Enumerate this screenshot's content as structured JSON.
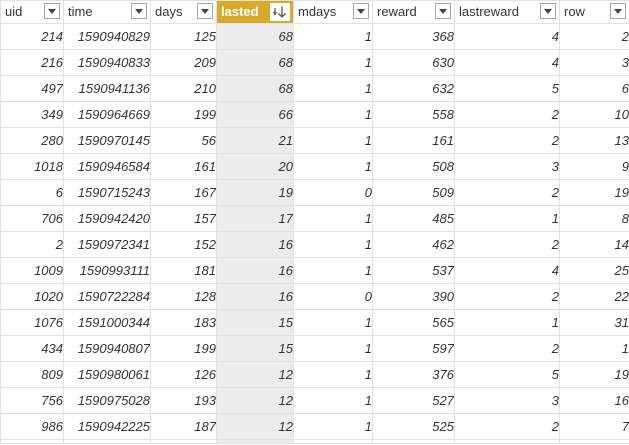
{
  "columns": [
    {
      "label": "uid"
    },
    {
      "label": "time"
    },
    {
      "label": "days"
    },
    {
      "label": "lasted"
    },
    {
      "label": "mdays"
    },
    {
      "label": "reward"
    },
    {
      "label": "lastreward"
    },
    {
      "label": "row"
    }
  ],
  "sorted_column": "lasted",
  "sort_direction": "descending",
  "header_accent_color": "#d8aa2a",
  "rows": [
    [
      "214",
      "1590940829",
      "125",
      "68",
      "1",
      "368",
      "4",
      "2"
    ],
    [
      "216",
      "1590940833",
      "209",
      "68",
      "1",
      "630",
      "4",
      "3"
    ],
    [
      "497",
      "1590941136",
      "210",
      "68",
      "1",
      "632",
      "5",
      "6"
    ],
    [
      "349",
      "1590964669",
      "199",
      "66",
      "1",
      "558",
      "2",
      "10"
    ],
    [
      "280",
      "1590970145",
      "56",
      "21",
      "1",
      "161",
      "2",
      "13"
    ],
    [
      "1018",
      "1590946584",
      "161",
      "20",
      "1",
      "508",
      "3",
      "9"
    ],
    [
      "6",
      "1590715243",
      "167",
      "19",
      "0",
      "509",
      "2",
      "19"
    ],
    [
      "706",
      "1590942420",
      "157",
      "17",
      "1",
      "485",
      "1",
      "8"
    ],
    [
      "2",
      "1590972341",
      "152",
      "16",
      "1",
      "462",
      "2",
      "14"
    ],
    [
      "1009",
      "1590993111",
      "181",
      "16",
      "1",
      "537",
      "4",
      "25"
    ],
    [
      "1020",
      "1590722284",
      "128",
      "16",
      "0",
      "390",
      "2",
      "22"
    ],
    [
      "1076",
      "1591000344",
      "183",
      "15",
      "1",
      "565",
      "1",
      "31"
    ],
    [
      "434",
      "1590940807",
      "199",
      "15",
      "1",
      "597",
      "2",
      "1"
    ],
    [
      "809",
      "1590980061",
      "126",
      "12",
      "1",
      "376",
      "5",
      "19"
    ],
    [
      "756",
      "1590975028",
      "193",
      "12",
      "1",
      "527",
      "3",
      "16"
    ],
    [
      "986",
      "1590942225",
      "187",
      "12",
      "1",
      "525",
      "2",
      "7"
    ]
  ]
}
